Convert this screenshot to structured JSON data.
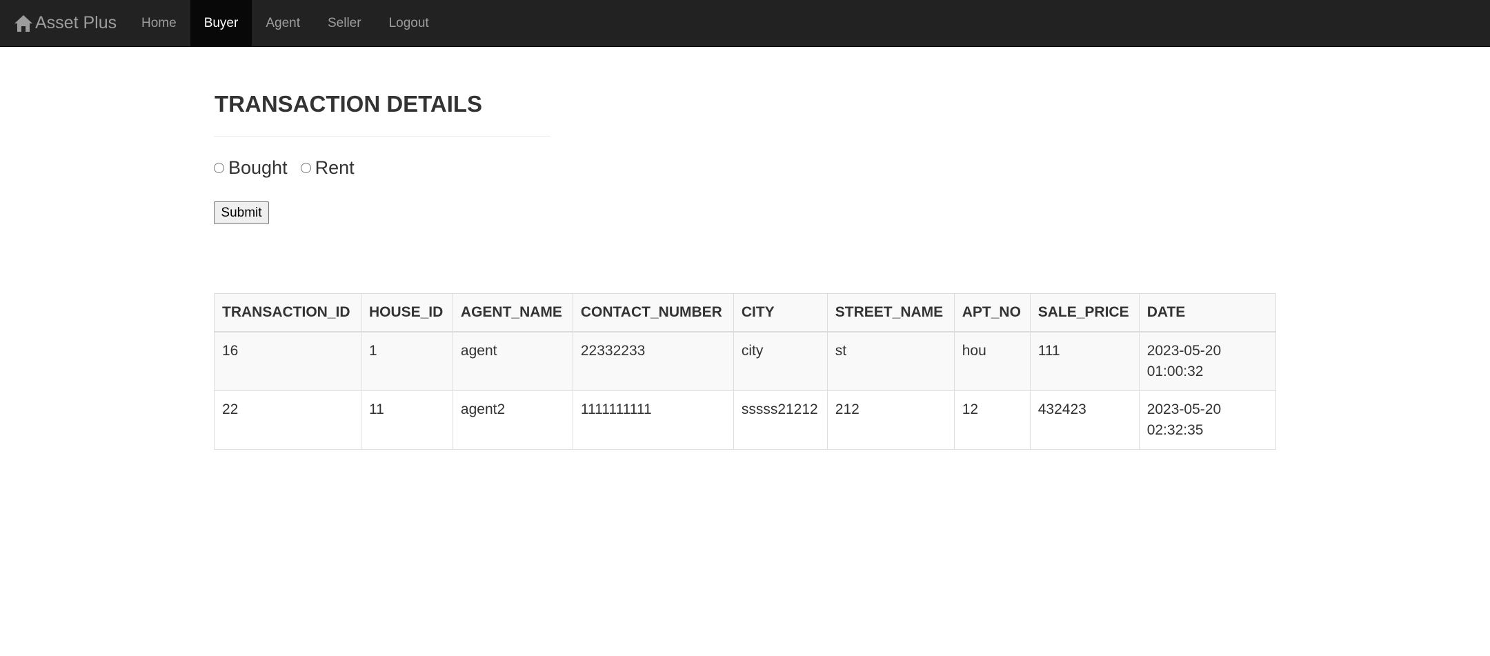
{
  "navbar": {
    "brand_label": "Asset Plus",
    "brand_icon": "home-icon",
    "items": [
      {
        "label": "Home",
        "active": false
      },
      {
        "label": "Buyer",
        "active": true
      },
      {
        "label": "Agent",
        "active": false
      },
      {
        "label": "Seller",
        "active": false
      },
      {
        "label": "Logout",
        "active": false
      }
    ],
    "colors": {
      "background": "#222222",
      "active_background": "#080808",
      "text": "#9d9d9d",
      "active_text": "#ffffff"
    }
  },
  "main": {
    "title": "TRANSACTION DETAILS",
    "filter": {
      "options": [
        {
          "label": "Bought",
          "checked": false
        },
        {
          "label": "Rent",
          "checked": false
        }
      ],
      "submit_label": "Submit"
    },
    "table": {
      "columns": [
        "TRANSACTION_ID",
        "HOUSE_ID",
        "AGENT_NAME",
        "CONTACT_NUMBER",
        "CITY",
        "STREET_NAME",
        "APT_NO",
        "SALE_PRICE",
        "DATE"
      ],
      "rows": [
        [
          "16",
          "1",
          "agent",
          "22332233",
          "city",
          "st",
          "hou",
          "111",
          "2023-05-20 01:00:32"
        ],
        [
          "22",
          "11",
          "agent2",
          "1111111111",
          "sssss21212",
          "212",
          "12",
          "432423",
          "2023-05-20 02:32:35"
        ]
      ]
    }
  }
}
